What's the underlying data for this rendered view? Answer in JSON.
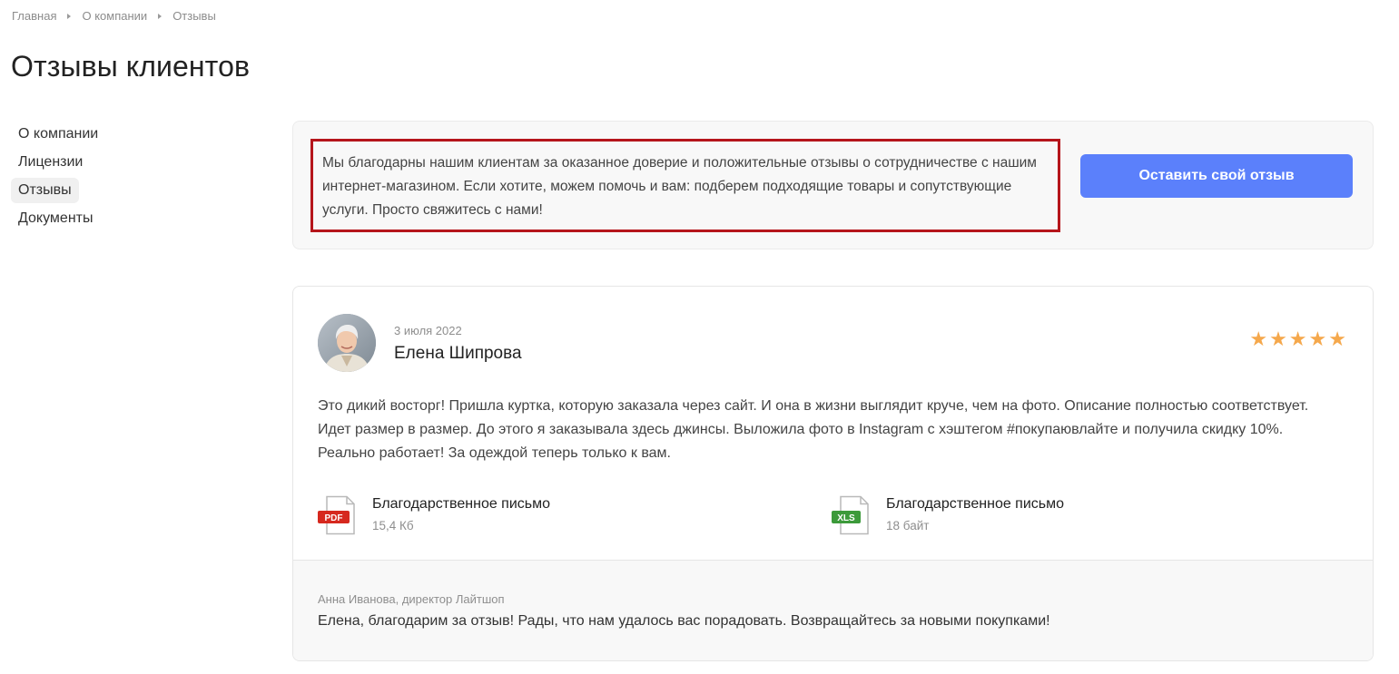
{
  "breadcrumb": [
    "Главная",
    "О компании",
    "Отзывы"
  ],
  "page_title": "Отзывы клиентов",
  "sidebar": {
    "items": [
      {
        "label": "О компании",
        "active": false
      },
      {
        "label": "Лицензии",
        "active": false
      },
      {
        "label": "Отзывы",
        "active": true
      },
      {
        "label": "Документы",
        "active": false
      }
    ]
  },
  "intro": {
    "text": "Мы благодарны нашим клиентам за оказанное доверие и положительные отзывы о сотрудничестве с нашим интернет-магазином. Если хотите, можем помочь и вам: подберем подходящие товары и сопутствующие услуги. Просто свяжитесь с нами!",
    "button_label": "Оставить свой отзыв"
  },
  "review": {
    "date": "3 июля 2022",
    "author": "Елена Шипрова",
    "rating": 5,
    "text": "Это дикий восторг! Пришла куртка, которую заказала через сайт. И она в жизни выглядит круче, чем на фото. Описание полностью соответствует. Идет размер в размер. До этого я заказывала здесь джинсы. Выложила фото в Instagram с хэштегом #покупаювлайте и получила скидку 10%. Реально работает! За одеждой теперь только к вам.",
    "files": [
      {
        "type": "PDF",
        "name": "Благодарственное письмо",
        "size": "15,4 Кб"
      },
      {
        "type": "XLS",
        "name": "Благодарственное письмо",
        "size": "18 байт"
      }
    ],
    "reply": {
      "author": "Анна Иванова, директор Лайтшоп",
      "text": "Елена, благодарим за отзыв! Рады, что нам удалось вас порадовать. Возвращайтесь за новыми покупками!"
    }
  },
  "colors": {
    "accent": "#5b80fb",
    "star": "#f5a84c",
    "highlight_border": "#b5151b",
    "pdf_badge": "#d6281e",
    "xls_badge": "#3c9a3a"
  }
}
